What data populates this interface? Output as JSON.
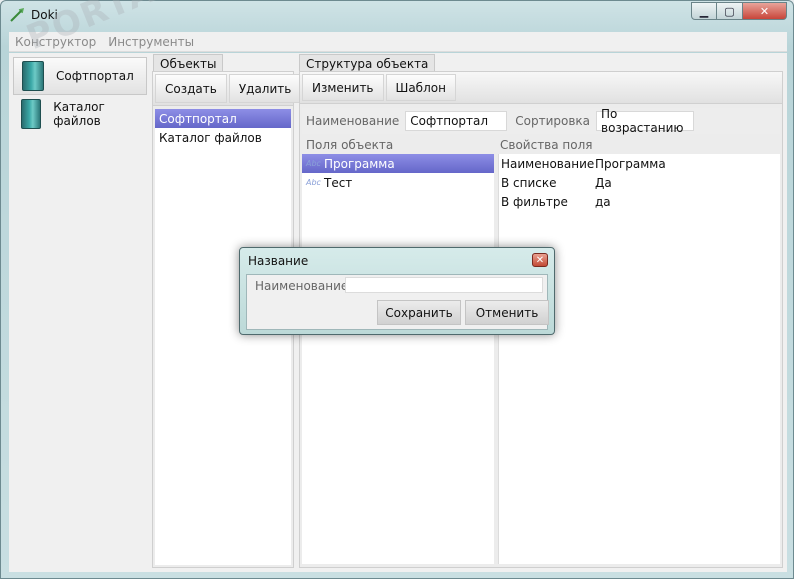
{
  "window": {
    "title": "Doki"
  },
  "menu": {
    "items": [
      "Конструктор",
      "Инструменты"
    ]
  },
  "nav": {
    "items": [
      {
        "label": "Софтпортал"
      },
      {
        "label": "Каталог файлов"
      }
    ]
  },
  "objects": {
    "tab_label": "Объекты",
    "create_label": "Создать",
    "delete_label": "Удалить",
    "items": [
      "Софтпортал",
      "Каталог файлов"
    ]
  },
  "structure": {
    "tab_label": "Структура объекта",
    "edit_label": "Изменить",
    "template_label": "Шаблон",
    "name_label": "Наименование",
    "name_value": "Софтпортал",
    "sort_label": "Сортировка",
    "sort_value": "По возрастанию",
    "fields_header": "Поля объекта",
    "fields": [
      {
        "type_icon": "Abc",
        "label": "Программа"
      },
      {
        "type_icon": "Abc",
        "label": "Тест"
      }
    ],
    "props_header": "Свойства поля",
    "props": [
      {
        "name": "Наименование",
        "value": "Программа"
      },
      {
        "name": "В списке",
        "value": "Да"
      },
      {
        "name": "В фильтре",
        "value": "да"
      }
    ]
  },
  "dialog": {
    "title": "Название",
    "field_label": "Наименование",
    "field_value": "",
    "save_label": "Сохранить",
    "cancel_label": "Отменить"
  },
  "watermark": {
    "text": "PORTAL"
  }
}
